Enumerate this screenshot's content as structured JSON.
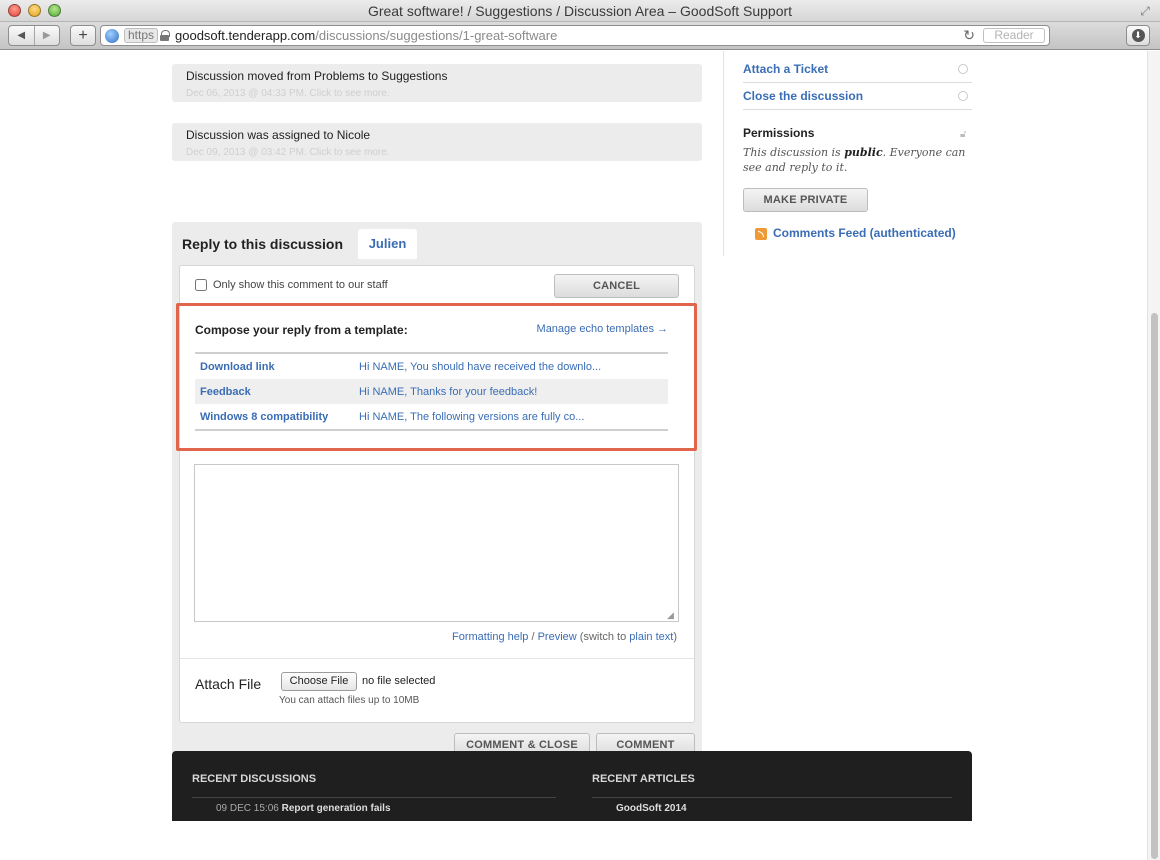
{
  "window": {
    "title": "Great software! / Suggestions / Discussion Area – GoodSoft Support"
  },
  "browser": {
    "https_label": "https",
    "url_host": "goodsoft.tenderapp.com",
    "url_path": "/discussions/suggestions/1-great-software",
    "reader_label": "Reader"
  },
  "events": [
    {
      "title": "Discussion moved from Problems to Suggestions",
      "meta": "Dec 06, 2013 @ 04:33 PM. Click to see more."
    },
    {
      "title": "Discussion was assigned to Nicole",
      "meta": "Dec 09, 2013 @ 03:42 PM. Click to see more."
    }
  ],
  "reply": {
    "heading": "Reply to this discussion",
    "user_tab": "Julien",
    "staff_only_label": "Only show this comment to our staff",
    "cancel_label": "CANCEL",
    "template_heading": "Compose your reply from a template:",
    "manage_templates": "Manage echo templates →",
    "templates": [
      {
        "name": "Download link",
        "preview": "Hi NAME,  You should have received the downlo..."
      },
      {
        "name": "Feedback",
        "preview": "Hi NAME,  Thanks for your feedback!"
      },
      {
        "name": "Windows 8 compatibility",
        "preview": "Hi NAME,  The following versions are fully co..."
      }
    ],
    "compose_value": "",
    "formatting_help": "Formatting help",
    "slash": " / ",
    "preview": "Preview",
    "switch_prefix": " (switch to ",
    "plain_text": "plain text",
    "switch_suffix": ")",
    "attach_label": "Attach File",
    "choose_file": "Choose File",
    "no_file": "no file selected",
    "attach_hint": "You can attach files up to 10MB",
    "comment_close_label": "COMMENT & CLOSE",
    "comment_label": "COMMENT"
  },
  "sidebar": {
    "attach_ticket": "Attach a Ticket",
    "close_discussion": "Close the discussion",
    "permissions_title": "Permissions",
    "perm_prefix": "This discussion is ",
    "perm_status": "public",
    "perm_suffix": ". Everyone can see and reply to it.",
    "make_private": "MAKE PRIVATE",
    "comments_feed": "Comments Feed (authenticated)"
  },
  "footer": {
    "recent_discussions": "RECENT DISCUSSIONS",
    "recent_articles": "RECENT ARTICLES",
    "discussion_item_date": "09 DEC 15:06",
    "discussion_item_title": "Report generation fails",
    "article_item_title": "GoodSoft 2014"
  },
  "colors": {
    "link": "#3a6db5",
    "highlight_frame": "#e0654a",
    "footer_bg": "#1f1f1f",
    "panel_bg": "#ececec"
  }
}
